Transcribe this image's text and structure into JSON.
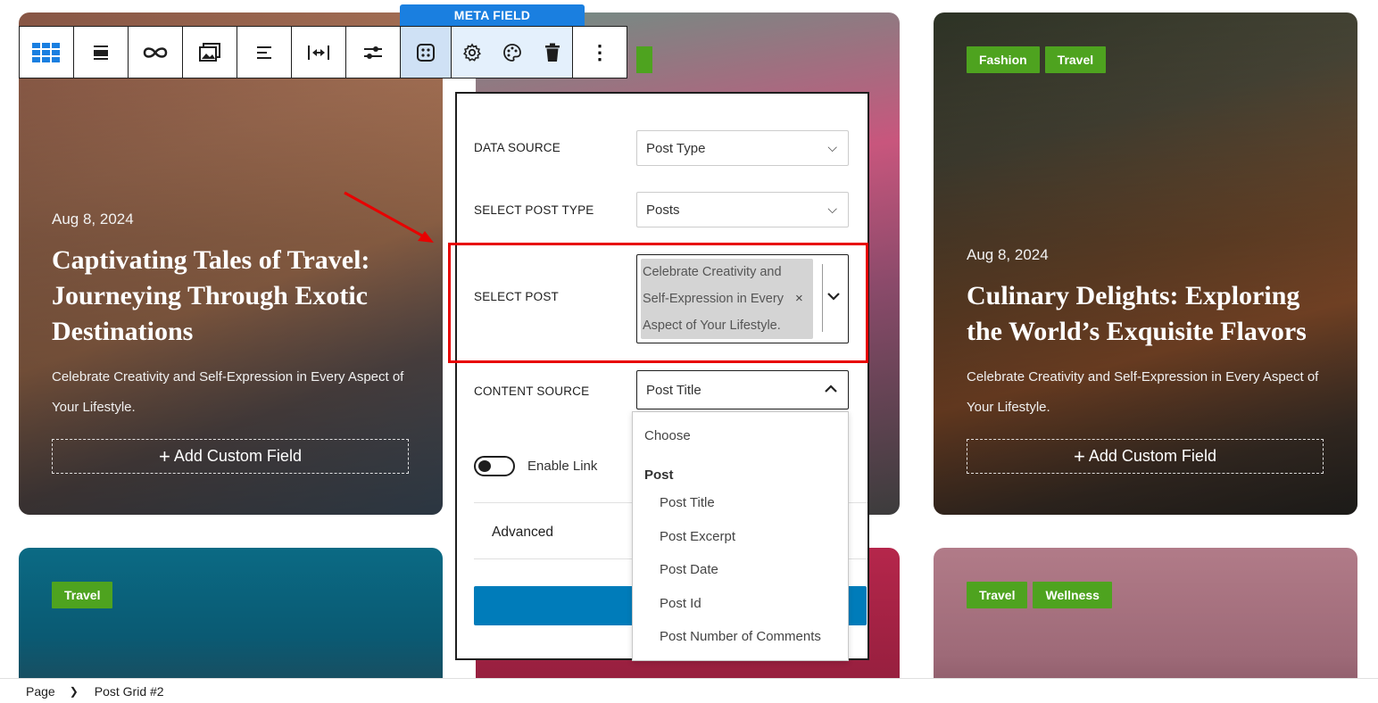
{
  "toolbar": {
    "buttons": [
      {
        "icon": "grid-layout-icon"
      },
      {
        "icon": "align-block-icon"
      },
      {
        "icon": "link-loop-icon"
      },
      {
        "icon": "image-gallery-icon"
      },
      {
        "icon": "text-align-left-icon"
      },
      {
        "icon": "width-arrows-icon"
      },
      {
        "icon": "sliders-icon"
      },
      {
        "icon": "meta-field-icon"
      },
      {
        "icon": "gear-icon"
      },
      {
        "icon": "palette-icon"
      },
      {
        "icon": "trash-icon"
      },
      {
        "icon": "more-vertical-icon"
      }
    ],
    "active_label": "META FIELD"
  },
  "cards": [
    {
      "date": "Aug 8, 2024",
      "title": "Captivating Tales of Travel: Journeying Through Exotic Destinations",
      "excerpt": "Celebrate Creativity and Self-Expression in Every Aspect of Your Lifestyle.",
      "add_field": "Add Custom Field"
    },
    {
      "tags": [
        "Fashion",
        "Travel"
      ],
      "date": "Aug 8, 2024",
      "title": "Culinary Delights: Exploring the World’s Exquisite Flavors",
      "excerpt": "Celebrate Creativity and Self-Expression in Every Aspect of Your Lifestyle.",
      "add_field": "Add Custom Field"
    },
    {
      "tags": [
        "Travel"
      ]
    },
    {
      "tags": [
        "Travel",
        "Wellness"
      ]
    }
  ],
  "panel": {
    "data_source_label": "DATA SOURCE",
    "data_source_value": "Post Type",
    "post_type_label": "SELECT POST TYPE",
    "post_type_value": "Posts",
    "select_post_label": "SELECT POST",
    "select_post_chip_lines": [
      "Celebrate Creativity and",
      "Self-Expression in Every",
      "Aspect of Your Lifestyle."
    ],
    "content_source_label": "CONTENT SOURCE",
    "content_source_value": "Post Title",
    "enable_link_label": "Enable Link",
    "advanced_label": "Advanced"
  },
  "dropdown": {
    "choose": "Choose",
    "group": "Post",
    "options": [
      "Post Title",
      "Post Excerpt",
      "Post Date",
      "Post Id",
      "Post Number of Comments"
    ]
  },
  "breadcrumb": {
    "root": "Page",
    "current": "Post Grid #2"
  },
  "colors": {
    "tag_green": "#4ea31f",
    "accent_blue": "#1a7fe0",
    "button_blue": "#007cba",
    "highlight_red": "#e80000"
  }
}
